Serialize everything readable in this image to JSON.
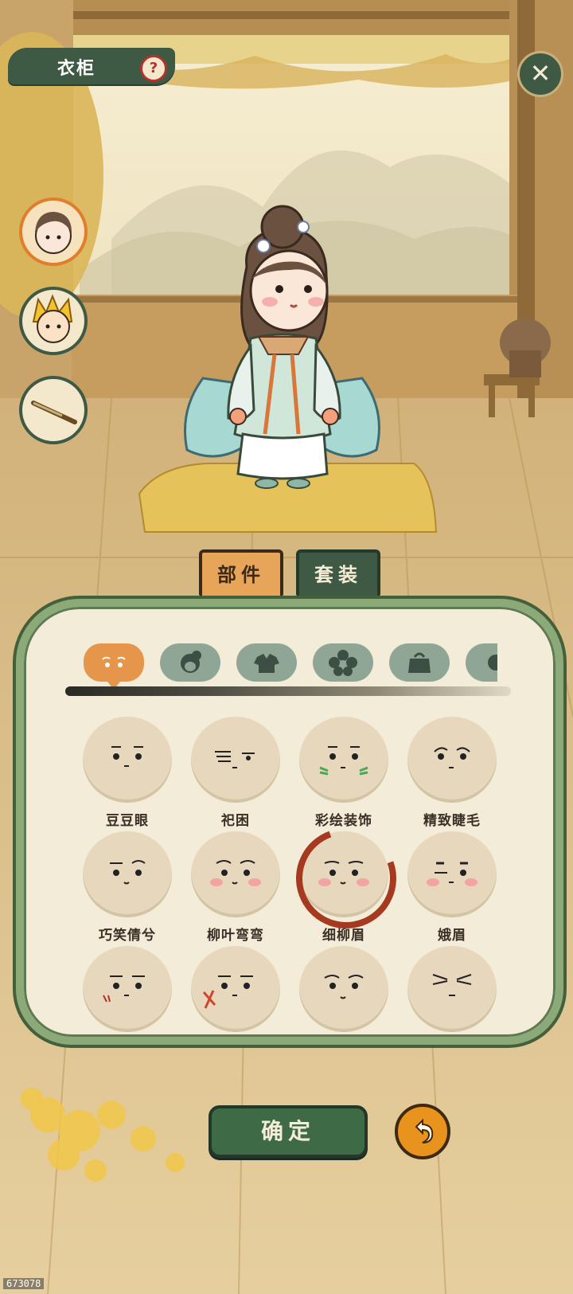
{
  "header": {
    "title": "衣柜",
    "help_symbol": "?",
    "close_symbol": "✕"
  },
  "tabs": [
    {
      "label": "部件",
      "active": true
    },
    {
      "label": "套装",
      "active": false
    }
  ],
  "categories": [
    {
      "icon": "eyes-category-icon",
      "active": true
    },
    {
      "icon": "hairstyle-category-icon",
      "active": false
    },
    {
      "icon": "clothes-category-icon",
      "active": false
    },
    {
      "icon": "flower-accessory-category-icon",
      "active": false
    },
    {
      "icon": "bag-category-icon",
      "active": false
    },
    {
      "icon": "more-category-icon",
      "active": false
    }
  ],
  "items": [
    {
      "label": "豆豆眼",
      "selected": false
    },
    {
      "label": "祀困",
      "selected": false
    },
    {
      "label": "彩绘装饰",
      "selected": false
    },
    {
      "label": "精致睫毛",
      "selected": false
    },
    {
      "label": "巧笑倩兮",
      "selected": false
    },
    {
      "label": "柳叶弯弯",
      "selected": false
    },
    {
      "label": "细柳眉",
      "selected": true
    },
    {
      "label": "娥眉",
      "selected": false
    },
    {
      "label": "",
      "selected": false
    },
    {
      "label": "",
      "selected": false
    },
    {
      "label": "",
      "selected": false
    },
    {
      "label": "",
      "selected": false
    }
  ],
  "actions": {
    "confirm": "确定",
    "undo_icon": "undo-arrow-icon"
  },
  "watermark": "673078",
  "colors": {
    "primary_green": "#3e5a44",
    "accent_orange": "#e5964a",
    "panel_bg": "#f2ecd9",
    "selection_red": "#a63a21"
  }
}
